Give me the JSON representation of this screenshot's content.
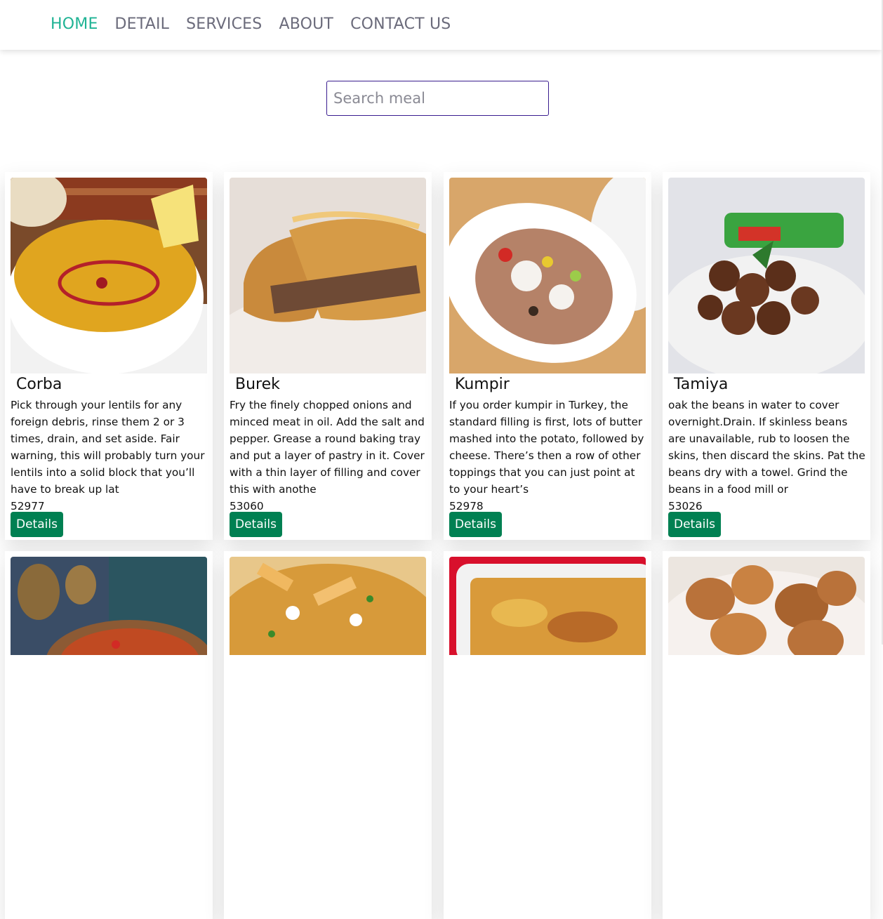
{
  "nav": {
    "links": [
      "HOME",
      "DETAIL",
      "SERVICES",
      "ABOUT",
      "CONTACT US"
    ],
    "active": "HOME"
  },
  "search": {
    "placeholder": "Search meal",
    "value": ""
  },
  "colors": {
    "accent": "#1fb394",
    "button": "#008052",
    "search_border": "#3a1d8f"
  },
  "meals": [
    {
      "name": "Corba",
      "description": "Pick through your lentils for any foreign debris, rinse them 2 or 3 times, drain, and set aside. Fair warning, this will probably turn your lentils into a solid block that you’ll have to break up lat",
      "id": "52977",
      "button": "Details"
    },
    {
      "name": "Burek",
      "description": "Fry the finely chopped onions and minced meat in oil. Add the salt and pepper. Grease a round baking tray and put a layer of pastry in it. Cover with a thin layer of filling and cover this with anothe",
      "id": "53060",
      "button": "Details"
    },
    {
      "name": "Kumpir",
      "description": "If you order kumpir in Turkey, the standard filling is first, lots of butter mashed into the potato, followed by cheese. There’s then a row of other toppings that you can just point at to your heart’s",
      "id": "52978",
      "button": "Details"
    },
    {
      "name": "Tamiya",
      "description": "oak the beans in water to cover overnight.Drain. If skinless beans are unavailable, rub to loosen the skins, then discard the skins. Pat the beans dry with a towel. Grind the beans in a food mill or",
      "id": "53026",
      "button": "Details"
    }
  ]
}
